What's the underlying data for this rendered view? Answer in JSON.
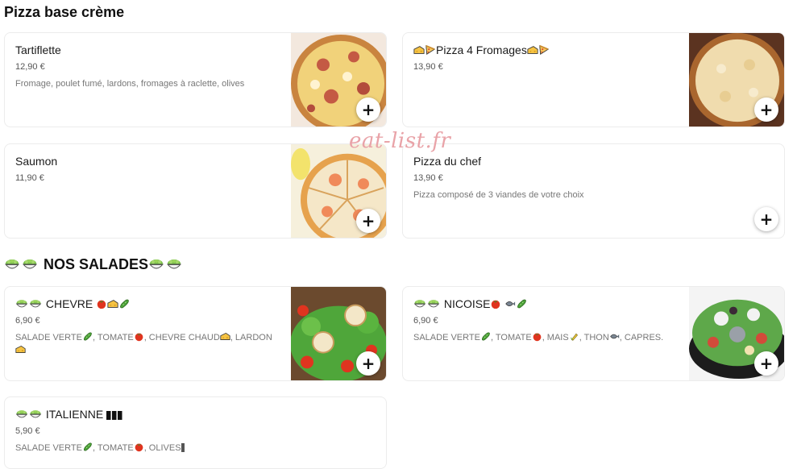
{
  "sections": {
    "pizza_creme": "Pizza base crème",
    "salades": "NOS SALADES"
  },
  "watermark": "eat-list.fr",
  "items": {
    "tartiflette": {
      "name": "Tartiflette",
      "price": "12,90 €",
      "description": "Fromage, poulet fumé, lardons, fromages à raclette, olives"
    },
    "pizza4": {
      "name": "Pizza 4 Fromages",
      "price": "13,90 €"
    },
    "saumon": {
      "name": "Saumon",
      "price": "11,90 €"
    },
    "chef": {
      "name": "Pizza du chef",
      "price": "13,90 €",
      "description": "Pizza composé de 3 viandes de votre choix"
    },
    "chevre": {
      "name": "CHEVRE",
      "price": "6,90 €",
      "desc_parts": [
        "SALADE VERTE",
        ", TOMATE",
        ", CHEVRE CHAUD",
        ", LARDON"
      ]
    },
    "nicoise": {
      "name": "NICOISE",
      "price": "6,90 €",
      "desc_parts": [
        "SALADE VERTE",
        ", TOMATE",
        ", MAIS",
        ", THON",
        ", CAPRES."
      ]
    },
    "italienne": {
      "name": "ITALIENNE",
      "price": "5,90 €",
      "desc_parts": [
        "SALADE VERTE",
        ", TOMATE",
        ", OLIVES"
      ]
    }
  },
  "add_label": "+",
  "icons": [
    "salad-icon",
    "cheese-icon",
    "pizza-slice-icon",
    "tomato-icon",
    "cucumber-icon",
    "corn-icon",
    "fish-icon",
    "flag-italy-icon"
  ]
}
